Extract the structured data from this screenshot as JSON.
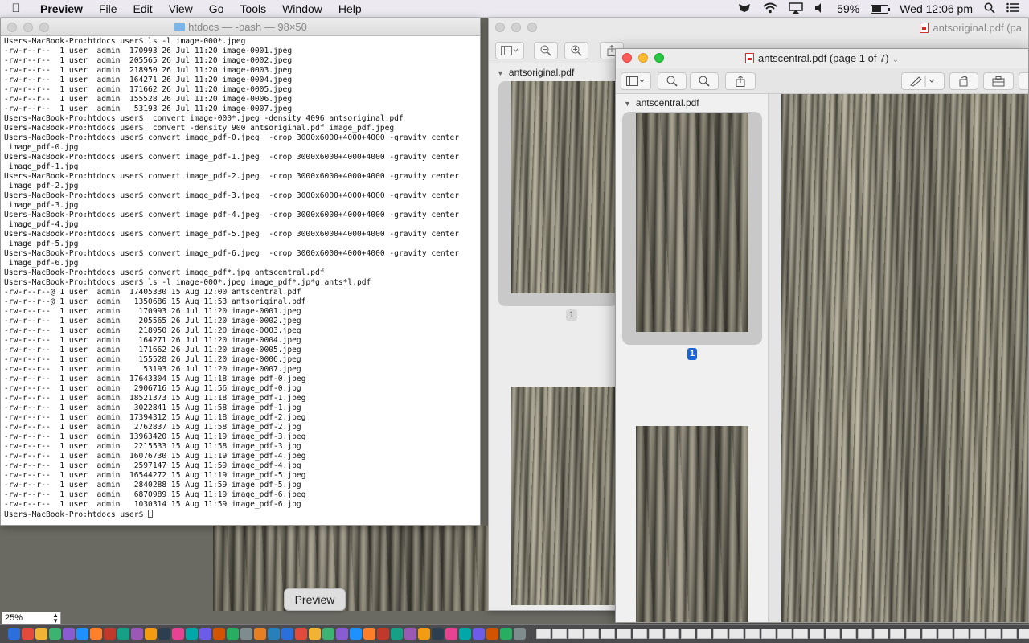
{
  "menubar": {
    "app_name": "Preview",
    "items": [
      "File",
      "Edit",
      "View",
      "Go",
      "Tools",
      "Window",
      "Help"
    ],
    "battery_percent": "59%",
    "battery_level": 0.59,
    "clock": "Wed 12:06 pm",
    "status_icons": [
      "mask-icon",
      "wifi-icon",
      "airplay-icon",
      "volume-icon"
    ]
  },
  "terminal": {
    "title": "htdocs — -bash — 98×50",
    "lines": [
      "Users-MacBook-Pro:htdocs user$ ls -l image-000*.jpeg",
      "-rw-r--r--  1 user  admin  170993 26 Jul 11:20 image-0001.jpeg",
      "-rw-r--r--  1 user  admin  205565 26 Jul 11:20 image-0002.jpeg",
      "-rw-r--r--  1 user  admin  218950 26 Jul 11:20 image-0003.jpeg",
      "-rw-r--r--  1 user  admin  164271 26 Jul 11:20 image-0004.jpeg",
      "-rw-r--r--  1 user  admin  171662 26 Jul 11:20 image-0005.jpeg",
      "-rw-r--r--  1 user  admin  155528 26 Jul 11:20 image-0006.jpeg",
      "-rw-r--r--  1 user  admin   53193 26 Jul 11:20 image-0007.jpeg",
      "Users-MacBook-Pro:htdocs user$  convert image-000*.jpeg -density 4096 antsoriginal.pdf",
      "Users-MacBook-Pro:htdocs user$  convert -density 900 antsoriginal.pdf image_pdf.jpeg",
      "Users-MacBook-Pro:htdocs user$ convert image_pdf-0.jpeg  -crop 3000x6000+4000+4000 -gravity center",
      " image_pdf-0.jpg",
      "Users-MacBook-Pro:htdocs user$ convert image_pdf-1.jpeg  -crop 3000x6000+4000+4000 -gravity center",
      " image_pdf-1.jpg",
      "Users-MacBook-Pro:htdocs user$ convert image_pdf-2.jpeg  -crop 3000x6000+4000+4000 -gravity center",
      " image_pdf-2.jpg",
      "Users-MacBook-Pro:htdocs user$ convert image_pdf-3.jpeg  -crop 3000x6000+4000+4000 -gravity center",
      " image_pdf-3.jpg",
      "Users-MacBook-Pro:htdocs user$ convert image_pdf-4.jpeg  -crop 3000x6000+4000+4000 -gravity center",
      " image_pdf-4.jpg",
      "Users-MacBook-Pro:htdocs user$ convert image_pdf-5.jpeg  -crop 3000x6000+4000+4000 -gravity center",
      " image_pdf-5.jpg",
      "Users-MacBook-Pro:htdocs user$ convert image_pdf-6.jpeg  -crop 3000x6000+4000+4000 -gravity center",
      " image_pdf-6.jpg",
      "Users-MacBook-Pro:htdocs user$ convert image_pdf*.jpg antscentral.pdf",
      "Users-MacBook-Pro:htdocs user$ ls -l image-000*.jpeg image_pdf*.jp*g ants*l.pdf",
      "-rw-r--r--@ 1 user  admin  17405330 15 Aug 12:00 antscentral.pdf",
      "-rw-r--r--@ 1 user  admin   1350686 15 Aug 11:53 antsoriginal.pdf",
      "-rw-r--r--  1 user  admin    170993 26 Jul 11:20 image-0001.jpeg",
      "-rw-r--r--  1 user  admin    205565 26 Jul 11:20 image-0002.jpeg",
      "-rw-r--r--  1 user  admin    218950 26 Jul 11:20 image-0003.jpeg",
      "-rw-r--r--  1 user  admin    164271 26 Jul 11:20 image-0004.jpeg",
      "-rw-r--r--  1 user  admin    171662 26 Jul 11:20 image-0005.jpeg",
      "-rw-r--r--  1 user  admin    155528 26 Jul 11:20 image-0006.jpeg",
      "-rw-r--r--  1 user  admin     53193 26 Jul 11:20 image-0007.jpeg",
      "-rw-r--r--  1 user  admin  17643304 15 Aug 11:18 image_pdf-0.jpeg",
      "-rw-r--r--  1 user  admin   2906716 15 Aug 11:56 image_pdf-0.jpg",
      "-rw-r--r--  1 user  admin  18521373 15 Aug 11:18 image_pdf-1.jpeg",
      "-rw-r--r--  1 user  admin   3022841 15 Aug 11:58 image_pdf-1.jpg",
      "-rw-r--r--  1 user  admin  17394312 15 Aug 11:18 image_pdf-2.jpeg",
      "-rw-r--r--  1 user  admin   2762837 15 Aug 11:58 image_pdf-2.jpg",
      "-rw-r--r--  1 user  admin  13963420 15 Aug 11:19 image_pdf-3.jpeg",
      "-rw-r--r--  1 user  admin   2215533 15 Aug 11:58 image_pdf-3.jpg",
      "-rw-r--r--  1 user  admin  16076730 15 Aug 11:19 image_pdf-4.jpeg",
      "-rw-r--r--  1 user  admin   2597147 15 Aug 11:59 image_pdf-4.jpg",
      "-rw-r--r--  1 user  admin  16544272 15 Aug 11:19 image_pdf-5.jpeg",
      "-rw-r--r--  1 user  admin   2840288 15 Aug 11:59 image_pdf-5.jpg",
      "-rw-r--r--  1 user  admin   6870989 15 Aug 11:19 image_pdf-6.jpeg",
      "-rw-r--r--  1 user  admin   1030314 15 Aug 11:59 image_pdf-6.jpg"
    ],
    "prompt": "Users-MacBook-Pro:htdocs user$ "
  },
  "preview_back": {
    "title": "antsoriginal.pdf (pa",
    "sidebar_heading": "antsoriginal.pdf",
    "page_number": "1"
  },
  "preview_front": {
    "title": "antscentral.pdf (page 1 of 7)",
    "sidebar_heading": "antscentral.pdf",
    "page_number": "1"
  },
  "tooltip": "Preview",
  "zoom": {
    "value": "25%"
  },
  "colors": {
    "accent_blue": "#1a63d8",
    "close_red": "#fc5f57",
    "minimize_yellow": "#fdbc2e",
    "zoom_green": "#28c840"
  }
}
